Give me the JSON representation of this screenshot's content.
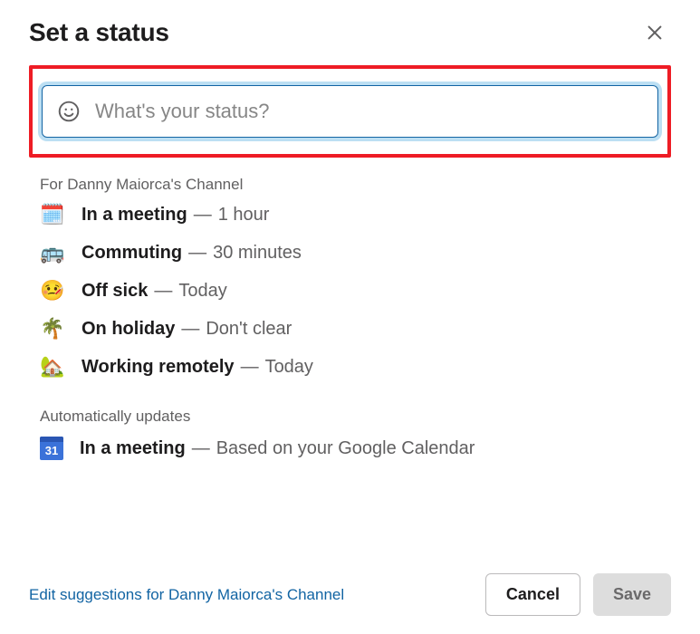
{
  "header": {
    "title": "Set a status"
  },
  "input": {
    "placeholder": "What's your status?",
    "value": ""
  },
  "section_for_label": "For Danny Maiorca's Channel",
  "suggestions": [
    {
      "icon": "🗓️",
      "label": "In a meeting",
      "duration": "1 hour"
    },
    {
      "icon": "🚌",
      "label": "Commuting",
      "duration": "30 minutes"
    },
    {
      "icon": "🤒",
      "label": "Off sick",
      "duration": "Today"
    },
    {
      "icon": "🌴",
      "label": "On holiday",
      "duration": "Don't clear"
    },
    {
      "icon": "🏡",
      "label": "Working remotely",
      "duration": "Today"
    }
  ],
  "auto_label": "Automatically updates",
  "auto_item": {
    "cal_day": "31",
    "label": "In a meeting",
    "duration": "Based on your Google Calendar"
  },
  "footer": {
    "edit_link": "Edit suggestions for Danny Maiorca's Channel",
    "cancel": "Cancel",
    "save": "Save"
  },
  "separator": "—"
}
